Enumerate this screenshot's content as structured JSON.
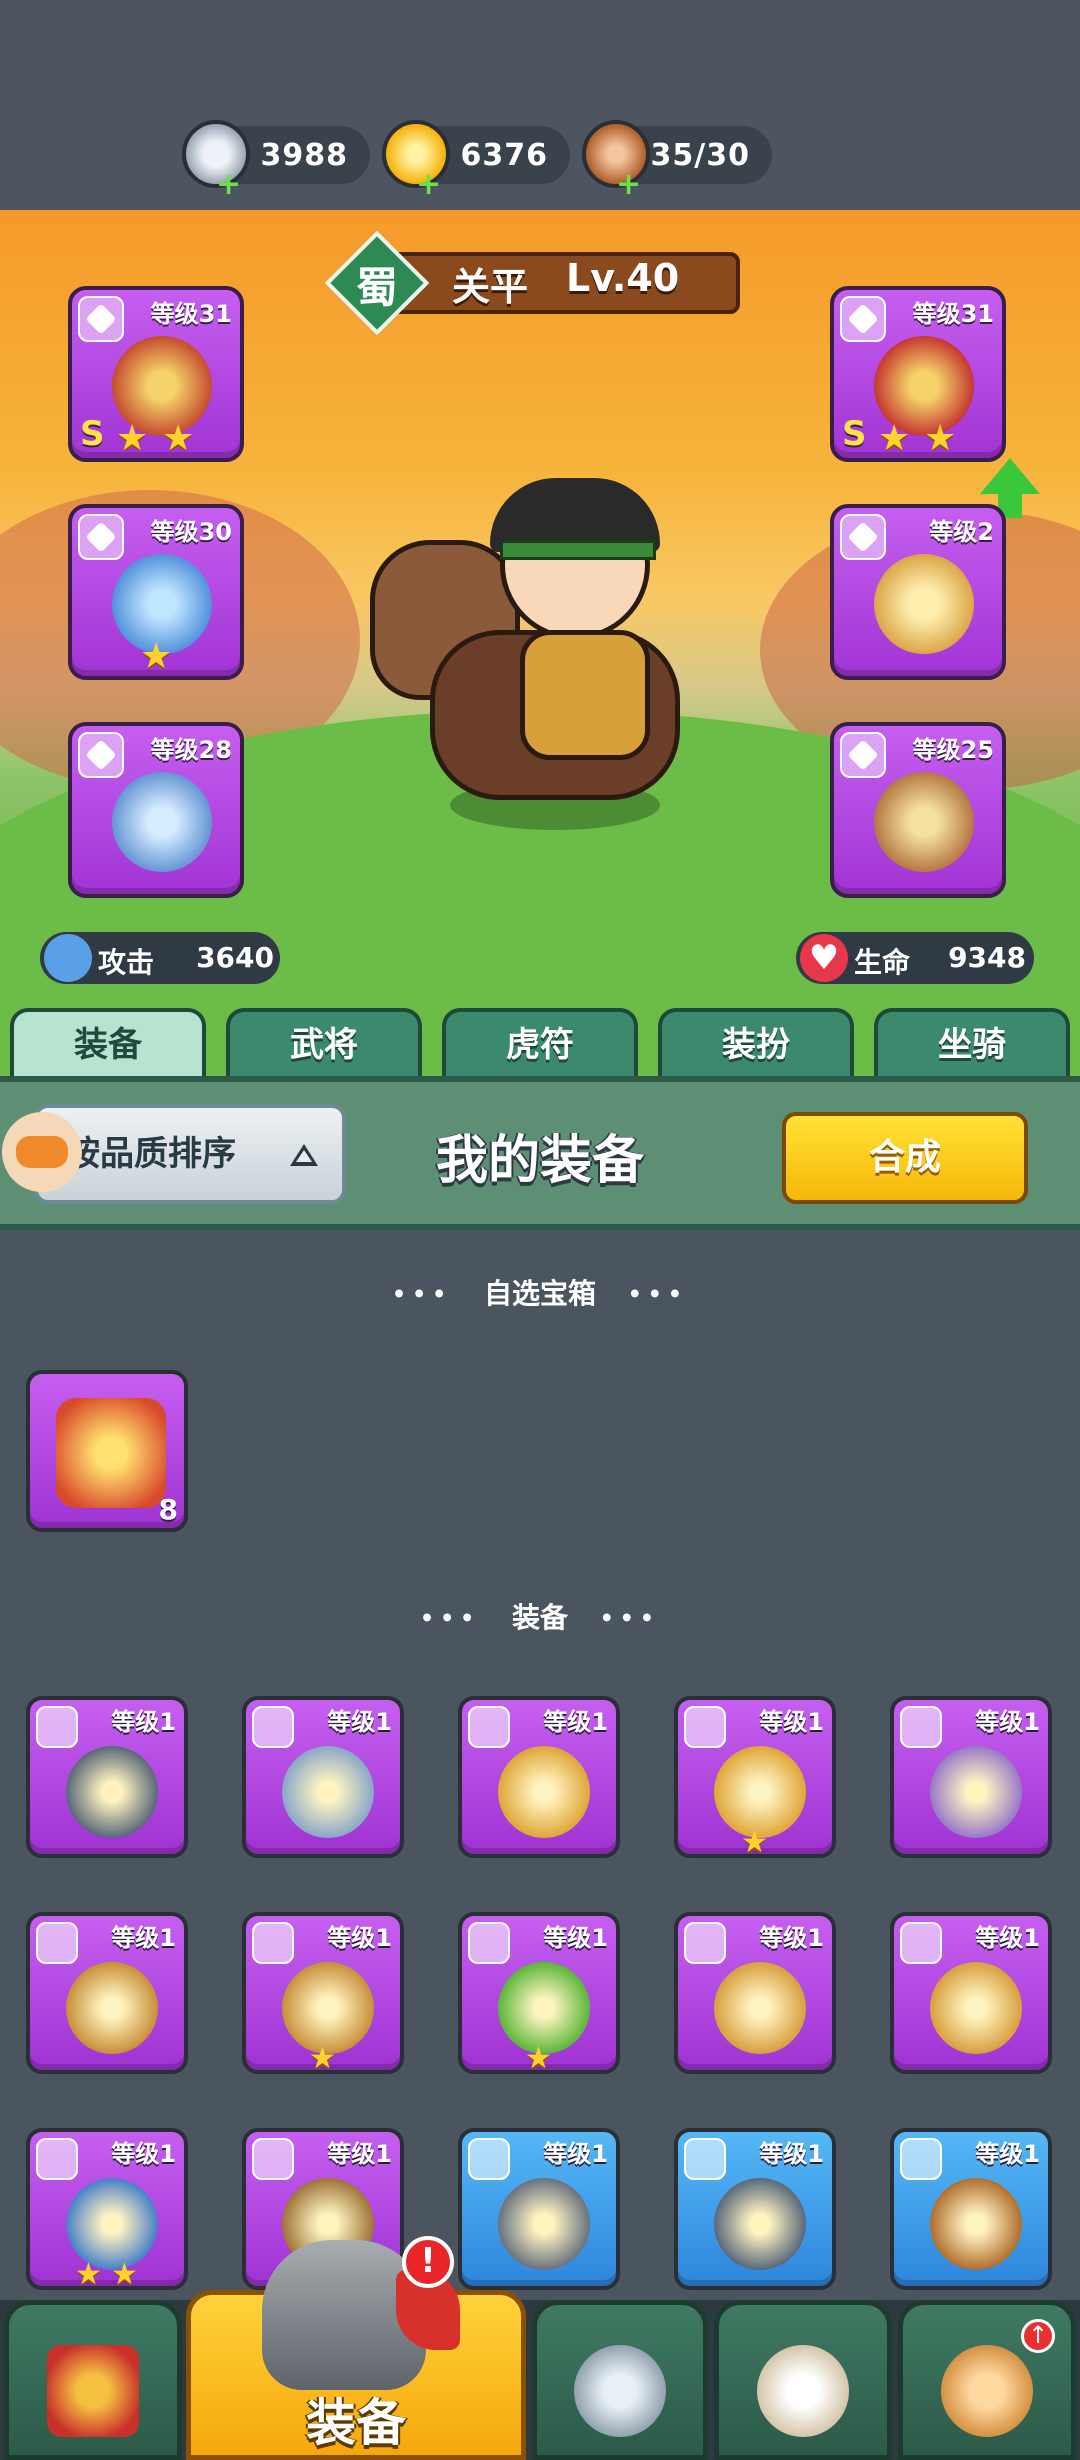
{
  "resources": [
    {
      "name": "silver-coin",
      "value": "3988",
      "color": "#c8d0dc"
    },
    {
      "name": "gold-ingot",
      "value": "6376",
      "color": "#f8c31a"
    },
    {
      "name": "meat-stamina",
      "value": "35/30",
      "color": "#c06a3a"
    }
  ],
  "hero": {
    "faction": "蜀",
    "name": "关平",
    "level": "Lv.40",
    "attack_label": "攻击",
    "attack_value": "3640",
    "hp_label": "生命",
    "hp_value": "9348"
  },
  "equip_slots": {
    "left": [
      {
        "level": "等级31",
        "grade": "S",
        "stars": 2,
        "art_color": "#e8b23a"
      },
      {
        "level": "等级30",
        "grade": "",
        "stars": 1,
        "art_color": "#6fb0e8"
      },
      {
        "level": "等级28",
        "grade": "",
        "stars": 0,
        "art_color": "#6f9ed8"
      }
    ],
    "right": [
      {
        "level": "等级31",
        "grade": "S",
        "stars": 2,
        "art_color": "#d83a2a"
      },
      {
        "level": "等级2",
        "grade": "",
        "stars": 0,
        "art_color": "#e0b050"
      },
      {
        "level": "等级25",
        "grade": "",
        "stars": 0,
        "art_color": "#c89a40"
      }
    ]
  },
  "tabs": [
    "装备",
    "武将",
    "虎符",
    "装扮",
    "坐骑"
  ],
  "panel": {
    "sort_label": "按品质排序",
    "title": "我的装备",
    "combine_label": "合成"
  },
  "sections": {
    "chest_title": "自选宝箱",
    "equip_title": "装备"
  },
  "chest": {
    "count": "8"
  },
  "inventory": [
    {
      "level": "等级1",
      "quality": "purple",
      "stars": 0,
      "art_color": "#5a6a7a"
    },
    {
      "level": "等级1",
      "quality": "purple",
      "stars": 0,
      "art_color": "#8aa8c8"
    },
    {
      "level": "等级1",
      "quality": "purple",
      "stars": 0,
      "art_color": "#e0a63a"
    },
    {
      "level": "等级1",
      "quality": "purple",
      "stars": 1,
      "art_color": "#e0a63a"
    },
    {
      "level": "等级1",
      "quality": "purple",
      "stars": 0,
      "art_color": "#9a7ac8"
    },
    {
      "level": "等级1",
      "quality": "purple",
      "stars": 0,
      "art_color": "#c8903a"
    },
    {
      "level": "等级1",
      "quality": "purple",
      "stars": 1,
      "art_color": "#c8903a"
    },
    {
      "level": "等级1",
      "quality": "purple",
      "stars": 1,
      "art_color": "#5ab83a"
    },
    {
      "level": "等级1",
      "quality": "purple",
      "stars": 0,
      "art_color": "#d8a040"
    },
    {
      "level": "等级1",
      "quality": "purple",
      "stars": 0,
      "art_color": "#d8a040"
    },
    {
      "level": "等级1",
      "quality": "purple",
      "stars": 2,
      "art_color": "#4a80c8"
    },
    {
      "level": "等级1",
      "quality": "purple",
      "stars": 1,
      "art_color": "#a0743a"
    },
    {
      "level": "等级1",
      "quality": "blue",
      "stars": 0,
      "art_color": "#6a7480"
    },
    {
      "level": "等级1",
      "quality": "blue",
      "stars": 0,
      "art_color": "#5a6a7a"
    },
    {
      "level": "等级1",
      "quality": "blue",
      "stars": 0,
      "art_color": "#b07030"
    }
  ],
  "bottom_nav": {
    "active_label": "装备",
    "alert": "!",
    "items": [
      "city-gate-icon",
      "helmet-icon",
      "shield-swords-icon",
      "scroll-stars-icon",
      "fist-upgrade-icon"
    ]
  }
}
